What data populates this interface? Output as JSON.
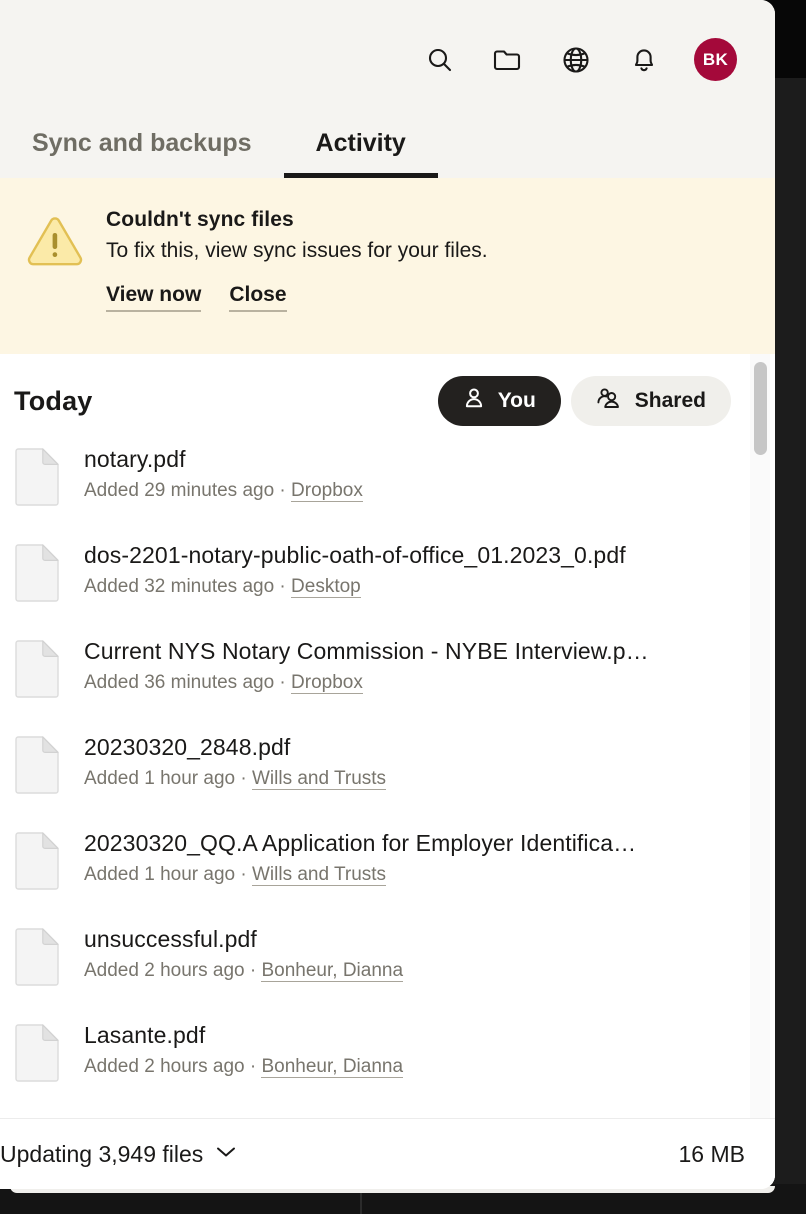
{
  "window": {
    "panel_background": "#ffffff",
    "header_background": "#f5f4f1",
    "accent_avatar": "#A4093A"
  },
  "header": {
    "icons": [
      {
        "name": "search-icon",
        "label": "Search"
      },
      {
        "name": "folder-icon",
        "label": "Files"
      },
      {
        "name": "globe-icon",
        "label": "Dropbox web"
      },
      {
        "name": "bell-icon",
        "label": "Notifications"
      }
    ],
    "avatar": {
      "initials": "BK",
      "color": "#A4093A"
    },
    "tabs": [
      {
        "label": "Sync and backups",
        "active": false
      },
      {
        "label": "Activity",
        "active": true
      }
    ]
  },
  "banner": {
    "icon": "warning-triangle-icon",
    "background": "#fdf6e3",
    "title": "Couldn't sync files",
    "text": "To fix this, view sync issues for your files.",
    "actions": [
      {
        "label": "View now",
        "name": "view-now-link"
      },
      {
        "label": "Close",
        "name": "close-banner-link"
      }
    ]
  },
  "activity": {
    "section_title": "Today",
    "filters": [
      {
        "label": "You",
        "icon": "person-icon",
        "selected": true
      },
      {
        "label": "Shared",
        "icon": "people-icon",
        "selected": false
      }
    ],
    "files": [
      {
        "name": "notary.pdf",
        "added": "Added 29 minutes ago",
        "separator": " · ",
        "location": "Dropbox"
      },
      {
        "name": "dos-2201-notary-public-oath-of-office_01.2023_0.pdf",
        "added": "Added 32 minutes ago",
        "separator": " · ",
        "location": "Desktop"
      },
      {
        "name": "Current NYS Notary Commission - NYBE Interview.p…",
        "added": "Added 36 minutes ago",
        "separator": " · ",
        "location": "Dropbox"
      },
      {
        "name": "20230320_2848.pdf",
        "added": "Added 1 hour ago",
        "separator": " · ",
        "location": "Wills and Trusts"
      },
      {
        "name": "20230320_QQ.A Application for Employer Identifica…",
        "added": "Added 1 hour ago",
        "separator": " · ",
        "location": "Wills and Trusts"
      },
      {
        "name": "unsuccessful.pdf",
        "added": "Added 2 hours ago",
        "separator": " · ",
        "location": "Bonheur, Dianna"
      },
      {
        "name": "Lasante.pdf",
        "added": "Added 2 hours ago",
        "separator": " · ",
        "location": "Bonheur, Dianna"
      }
    ]
  },
  "status": {
    "text": "Updating 3,949 files",
    "chevron": "chevron-down-icon",
    "size": "16 MB"
  }
}
